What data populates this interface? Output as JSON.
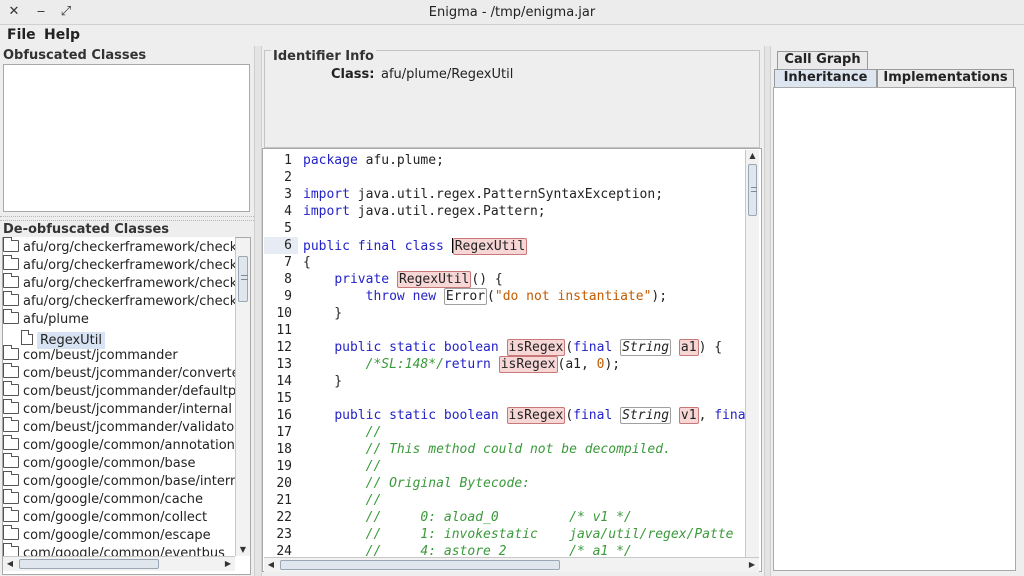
{
  "window": {
    "title": "Enigma - /tmp/enigma.jar",
    "close_glyph": "✕",
    "minimize_glyph": "‒",
    "maximize_glyph": "⤢"
  },
  "menu": {
    "file": "File",
    "help": "Help"
  },
  "obfuscated": {
    "label": "Obfuscated Classes"
  },
  "deobfuscated": {
    "label": "De-obfuscated Classes",
    "items": [
      {
        "label": "afu/org/checkerframework/checke",
        "kind": "folder"
      },
      {
        "label": "afu/org/checkerframework/checke",
        "kind": "folder"
      },
      {
        "label": "afu/org/checkerframework/checke",
        "kind": "folder"
      },
      {
        "label": "afu/org/checkerframework/checke",
        "kind": "folder"
      },
      {
        "label": "afu/plume",
        "kind": "folder"
      },
      {
        "label": "RegexUtil",
        "kind": "file"
      },
      {
        "label": "com/beust/jcommander",
        "kind": "folder"
      },
      {
        "label": "com/beust/jcommander/converter",
        "kind": "folder"
      },
      {
        "label": "com/beust/jcommander/defaultpro",
        "kind": "folder"
      },
      {
        "label": "com/beust/jcommander/internal",
        "kind": "folder"
      },
      {
        "label": "com/beust/jcommander/validators",
        "kind": "folder"
      },
      {
        "label": "com/google/common/annotations",
        "kind": "folder"
      },
      {
        "label": "com/google/common/base",
        "kind": "folder"
      },
      {
        "label": "com/google/common/base/interna",
        "kind": "folder"
      },
      {
        "label": "com/google/common/cache",
        "kind": "folder"
      },
      {
        "label": "com/google/common/collect",
        "kind": "folder"
      },
      {
        "label": "com/google/common/escape",
        "kind": "folder"
      },
      {
        "label": "com/google/common/eventbus",
        "kind": "folder"
      }
    ]
  },
  "identifier_info": {
    "label": "Identifier Info",
    "class_label": "Class:",
    "class_value": "afu/plume/RegexUtil"
  },
  "code": {
    "line_numbers": [
      "1",
      "2",
      "3",
      "4",
      "5",
      "6",
      "7",
      "8",
      "9",
      "10",
      "11",
      "12",
      "13",
      "14",
      "15",
      "16",
      "17",
      "18",
      "19",
      "20",
      "21",
      "22",
      "23",
      "24"
    ],
    "current_line": 6
  },
  "right_panel": {
    "tabs_top": [
      "Call Graph"
    ],
    "tabs_bottom": [
      "Inheritance",
      "Implementations"
    ],
    "active_tab": "Inheritance"
  }
}
